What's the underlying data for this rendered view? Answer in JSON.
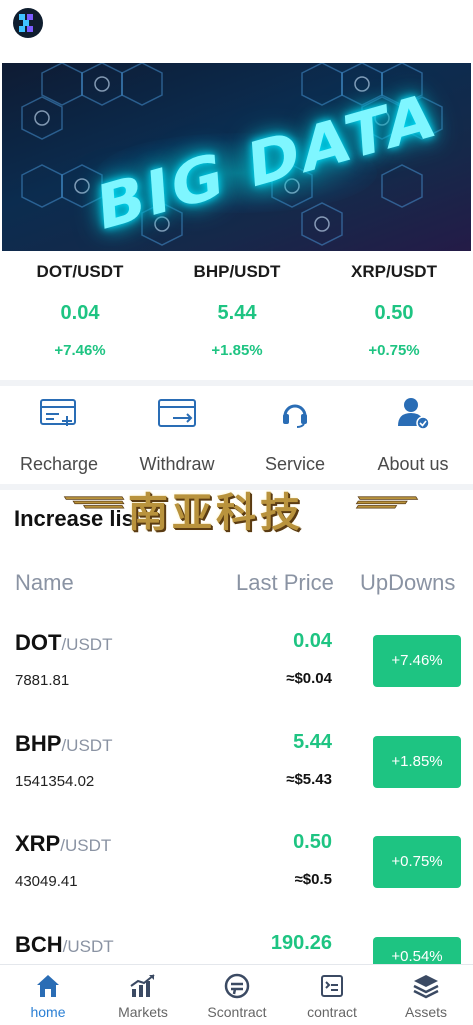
{
  "banner": {
    "headline": "BIG DATA",
    "slide_count": 3,
    "active_slide": 1
  },
  "tickers": [
    {
      "pair": "DOT/USDT",
      "price": "0.04",
      "change": "+7.46%"
    },
    {
      "pair": "BHP/USDT",
      "price": "5.44",
      "change": "+1.85%"
    },
    {
      "pair": "XRP/USDT",
      "price": "0.50",
      "change": "+0.75%"
    }
  ],
  "quick_actions": [
    {
      "label": "Recharge",
      "icon": "recharge-card-icon"
    },
    {
      "label": "Withdraw",
      "icon": "withdraw-card-icon"
    },
    {
      "label": "Service",
      "icon": "headset-icon"
    },
    {
      "label": "About us",
      "icon": "user-verified-icon"
    }
  ],
  "watermark_text": "南亚科技",
  "section_title": "Increase list",
  "table": {
    "headers": {
      "name": "Name",
      "last_price": "Last Price",
      "updowns": "UpDowns"
    },
    "rows": [
      {
        "base": "DOT",
        "quote": "/USDT",
        "volume": "7881.81",
        "price": "0.04",
        "usd": "≈$0.04",
        "change": "+7.46%"
      },
      {
        "base": "BHP",
        "quote": "/USDT",
        "volume": "1541354.02",
        "price": "5.44",
        "usd": "≈$5.43",
        "change": "+1.85%"
      },
      {
        "base": "XRP",
        "quote": "/USDT",
        "volume": "43049.41",
        "price": "0.50",
        "usd": "≈$0.5",
        "change": "+0.75%"
      },
      {
        "base": "BCH",
        "quote": "/USDT",
        "volume": "",
        "price": "190.26",
        "usd": "",
        "change": "+0.54%"
      }
    ]
  },
  "tabbar": [
    {
      "label": "home",
      "icon": "home-icon",
      "active": true
    },
    {
      "label": "Markets",
      "icon": "markets-chart-icon",
      "active": false
    },
    {
      "label": "Scontract",
      "icon": "scontract-icon",
      "active": false
    },
    {
      "label": "contract",
      "icon": "contract-doc-icon",
      "active": false
    },
    {
      "label": "Assets",
      "icon": "assets-layers-icon",
      "active": false
    }
  ],
  "colors": {
    "accent_green": "#1ec482",
    "active_tab_blue": "#2a7fd4",
    "icon_blue": "#2a6db5"
  }
}
